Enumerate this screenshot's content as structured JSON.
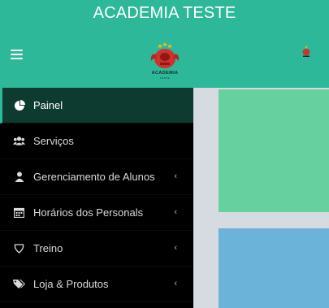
{
  "header": {
    "title": "ACADEMIA TESTE",
    "logo_text": "ACADEMIA",
    "logo_subtext": "TESTE",
    "brand_color": "#2db899",
    "menu_icon": "hamburger-icon",
    "avatar_icon": "user-logo-icon"
  },
  "sidebar": {
    "items": [
      {
        "label": "Painel",
        "icon": "dashboard-pie-icon",
        "active": true,
        "has_submenu": false
      },
      {
        "label": "Serviços",
        "icon": "users-icon",
        "active": false,
        "has_submenu": false
      },
      {
        "label": "Gerenciamento de Alunos",
        "icon": "user-icon",
        "active": false,
        "has_submenu": true
      },
      {
        "label": "Horários dos Personals",
        "icon": "calendar-icon",
        "active": false,
        "has_submenu": true
      },
      {
        "label": "Treino",
        "icon": "shield-icon",
        "active": false,
        "has_submenu": true
      },
      {
        "label": "Loja & Produtos",
        "icon": "tags-icon",
        "active": false,
        "has_submenu": true
      }
    ],
    "chevron_glyph": "‹"
  },
  "colors": {
    "sidebar_bg": "#000000",
    "active_bg": "#0e3b30",
    "tile_green": "#66d19e",
    "tile_blue": "#6cb3d9",
    "content_bg": "#d5dbe1"
  }
}
